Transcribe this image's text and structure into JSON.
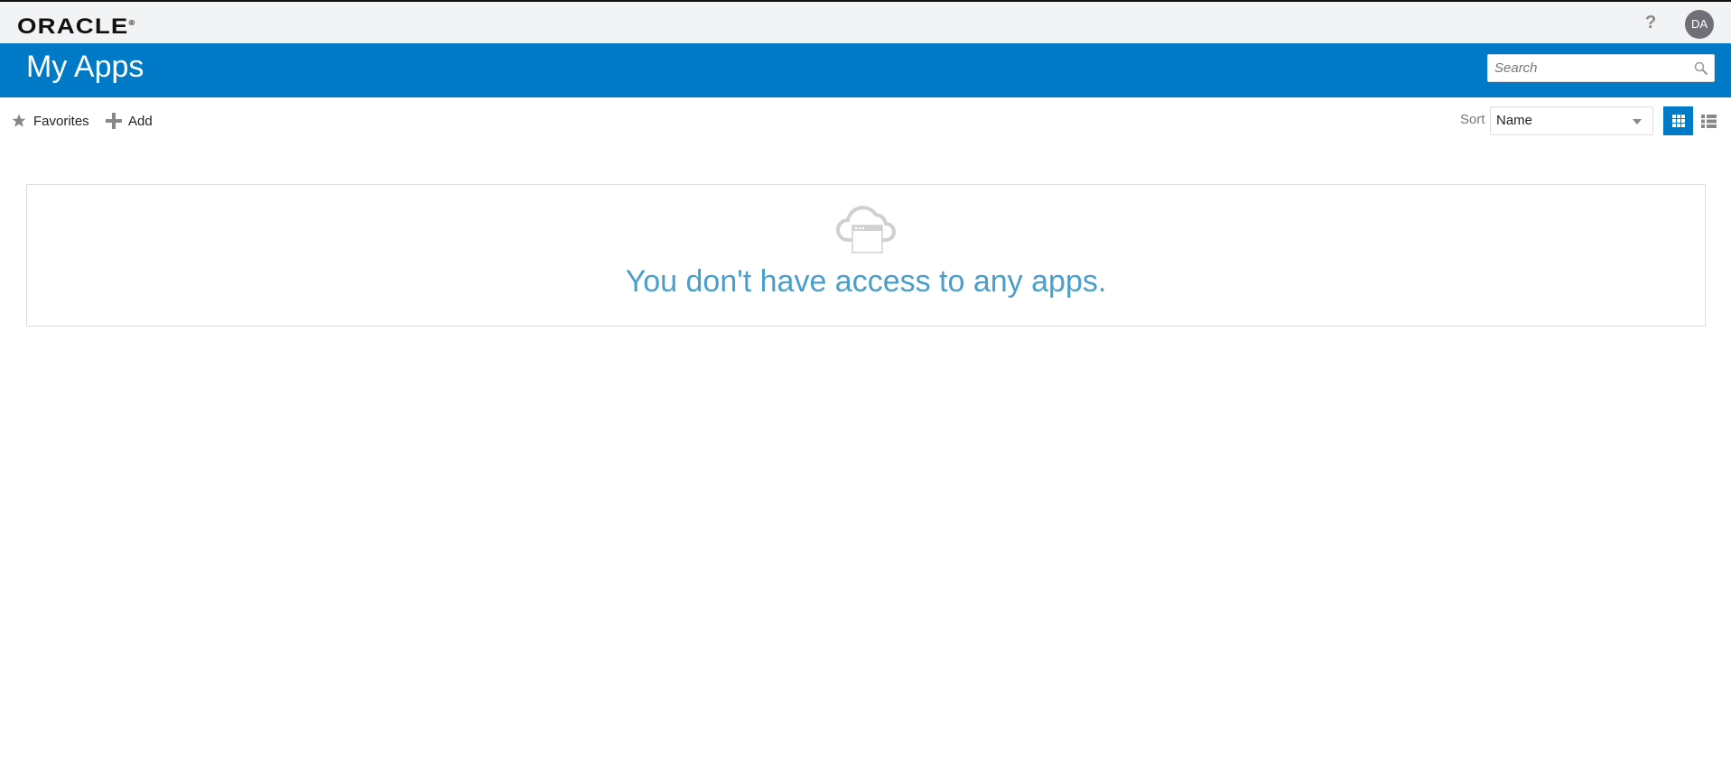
{
  "header": {
    "logo": "ORACLE",
    "help_label": "?",
    "avatar_initials": "DA"
  },
  "banner": {
    "title": "My Apps",
    "search_placeholder": "Search"
  },
  "toolbar": {
    "favorites_label": "Favorites",
    "add_label": "Add",
    "sort_label": "Sort",
    "sort_value": "Name",
    "view_mode": "grid"
  },
  "empty_state": {
    "icon": "cloud-app-icon",
    "message": "You don't have access to any apps."
  },
  "colors": {
    "brand_blue": "#007ac7",
    "message": "#4a9ecb"
  }
}
